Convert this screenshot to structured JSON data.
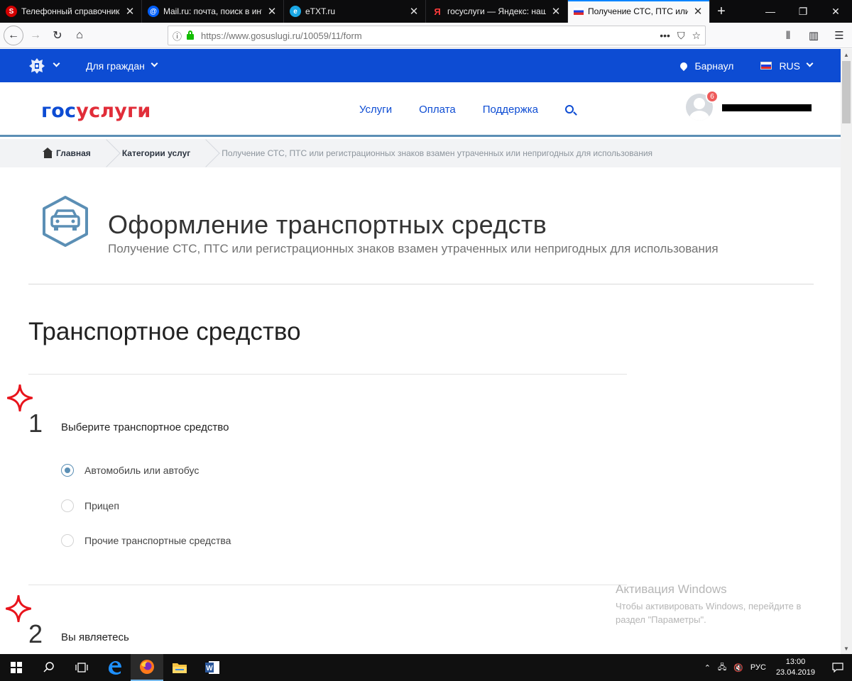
{
  "browser": {
    "tabs": [
      {
        "title": "Телефонный справочник",
        "favicon_color": "#d40000",
        "favicon_char": "S",
        "active": false
      },
      {
        "title": "Mail.ru: почта, поиск в интернете",
        "favicon_color": "#005ff9",
        "favicon_char": "@",
        "active": false
      },
      {
        "title": "eTXT.ru",
        "favicon_color": "#1aa8e6",
        "favicon_char": "e",
        "active": false
      },
      {
        "title": "госуслуги — Яндекс: нашлось",
        "favicon_color": "#ff0000",
        "favicon_char": "Я",
        "active": false
      },
      {
        "title": "Получение СТС, ПТС или регистрационных",
        "favicon_color": "#1c3fe0",
        "favicon_char": "",
        "active": true
      }
    ],
    "url": "https://www.gosuslugi.ru/10059/11/form",
    "url_actions": "•••"
  },
  "site": {
    "top_menu": "Для граждан",
    "city": "Барнаул",
    "lang": "RUS",
    "logo_part1": "гос",
    "logo_part2": "услуги",
    "nav": [
      "Услуги",
      "Оплата",
      "Поддержка"
    ],
    "notifications_count": "6"
  },
  "breadcrumbs": {
    "home": "Главная",
    "categories": "Категории услуг",
    "current": "Получение СТС, ПТС или регистрационных знаков взамен утраченных или непригодных для использования"
  },
  "page": {
    "title": "Оформление транспортных средств",
    "subtitle": "Получение СТС, ПТС или регистрационных знаков взамен утраченных или непригодных для использования",
    "section_title": "Транспортное средство"
  },
  "steps": [
    {
      "number": "1",
      "label": "Выберите транспортное средство",
      "options": [
        {
          "label": "Автомобиль или автобус",
          "checked": true
        },
        {
          "label": "Прицеп",
          "checked": false
        },
        {
          "label": "Прочие транспортные средства",
          "checked": false
        }
      ]
    },
    {
      "number": "2",
      "label": "Вы являетесь"
    }
  ],
  "watermark": {
    "title": "Активация Windows",
    "text": "Чтобы активировать Windows, перейдите в раздел \"Параметры\"."
  },
  "taskbar": {
    "lang": "РУС",
    "time": "13:00",
    "date": "23.04.2019"
  },
  "colors": {
    "brand_blue": "#0d4cd3",
    "brand_red": "#e12d39",
    "accent": "#5b8fb5"
  }
}
